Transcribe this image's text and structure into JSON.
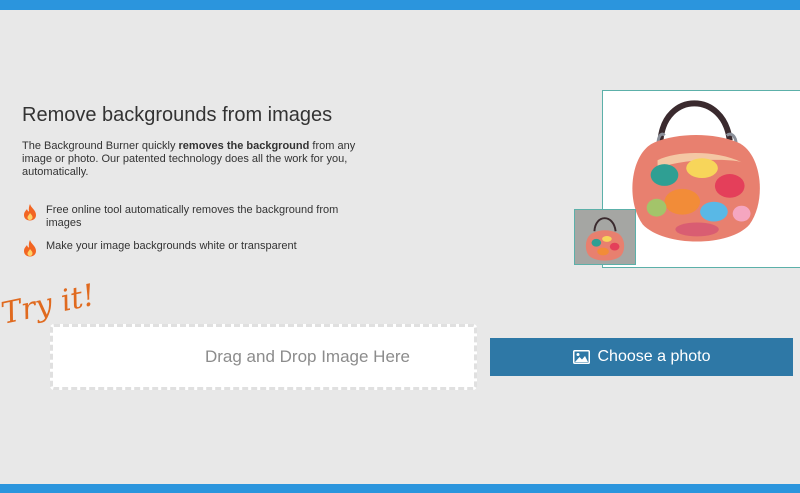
{
  "hero": {
    "title": "Remove backgrounds from images",
    "intro_before": "The Background Burner quickly ",
    "intro_bold": "removes the background",
    "intro_after": " from any image or photo. Our patented technology does all the work for you, automatically."
  },
  "features": [
    {
      "icon": "flame-icon",
      "text": "Free online tool automatically removes the background from images"
    },
    {
      "icon": "flame-icon",
      "text": "Make your image backgrounds white or transparent"
    }
  ],
  "try_it_label": "Try it!",
  "upload": {
    "dropzone_label": "Drag and Drop Image Here",
    "choose_button_label": "Choose a photo",
    "choose_button_icon": "image-icon"
  },
  "colors": {
    "accent_blue": "#2b95dd",
    "button_blue": "#2e78a6",
    "flame_orange": "#f26522",
    "try_it_orange": "#e06a1f",
    "preview_border": "#5cb0a9"
  }
}
